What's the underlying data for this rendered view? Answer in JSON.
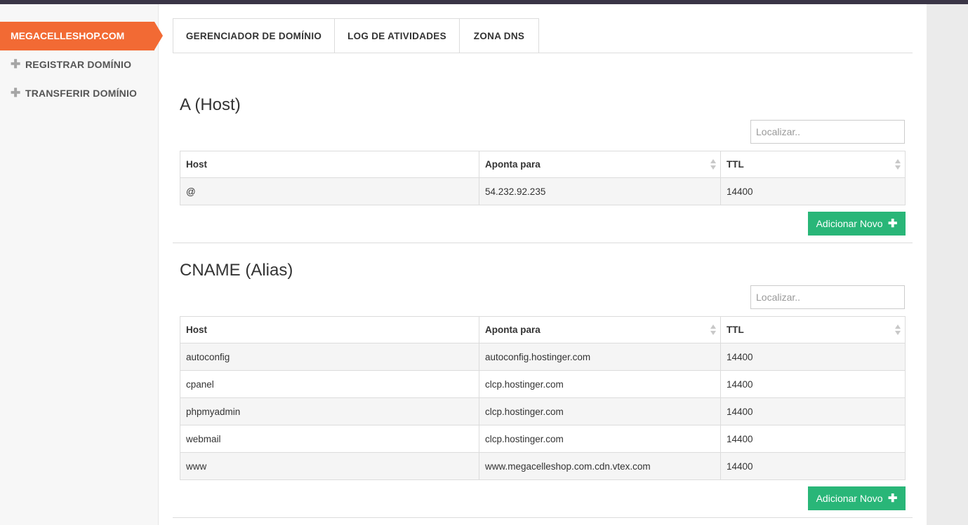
{
  "sidebar": {
    "domain": "MEGACELLESHOP.COM",
    "items": [
      {
        "icon": "plus-icon",
        "label": "REGISTRAR DOMÍNIO"
      },
      {
        "icon": "plus-icon",
        "label": "TRANSFERIR DOMÍNIO"
      }
    ]
  },
  "tabs": [
    {
      "label": "GERENCIADOR DE DOMÍNIO",
      "active": false
    },
    {
      "label": "LOG DE ATIVIDADES",
      "active": false
    },
    {
      "label": "ZONA DNS",
      "active": true
    }
  ],
  "sections": [
    {
      "title": "A (Host)",
      "search_placeholder": "Localizar..",
      "columns": [
        "Host",
        "Aponta para",
        "TTL"
      ],
      "rows": [
        [
          "@",
          "54.232.92.235",
          "14400"
        ]
      ],
      "add_label": "Adicionar Novo"
    },
    {
      "title": "CNAME (Alias)",
      "search_placeholder": "Localizar..",
      "columns": [
        "Host",
        "Aponta para",
        "TTL"
      ],
      "rows": [
        [
          "autoconfig",
          "autoconfig.hostinger.com",
          "14400"
        ],
        [
          "cpanel",
          "clcp.hostinger.com",
          "14400"
        ],
        [
          "phpmyadmin",
          "clcp.hostinger.com",
          "14400"
        ],
        [
          "webmail",
          "clcp.hostinger.com",
          "14400"
        ],
        [
          "www",
          "www.megacelleshop.com.cdn.vtex.com",
          "14400"
        ]
      ],
      "add_label": "Adicionar Novo"
    }
  ],
  "colors": {
    "accent": "#f26a34",
    "button": "#29b678",
    "topbar": "#3a3546"
  }
}
